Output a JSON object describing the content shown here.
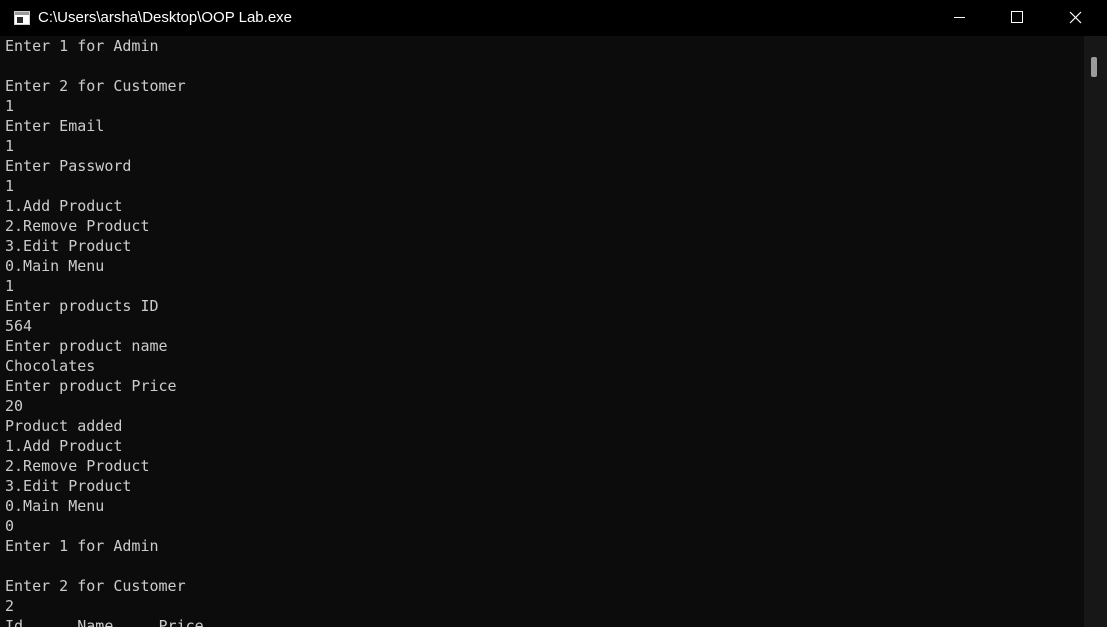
{
  "window": {
    "title": "C:\\Users\\arsha\\Desktop\\OOP Lab.exe"
  },
  "console": {
    "lines": [
      "Enter 1 for Admin",
      "",
      "Enter 2 for Customer",
      "1",
      "Enter Email",
      "1",
      "Enter Password",
      "1",
      "1.Add Product",
      "2.Remove Product",
      "3.Edit Product",
      "0.Main Menu",
      "1",
      "Enter products ID",
      "564",
      "Enter product name",
      "Chocolates",
      "Enter product Price",
      "20",
      "Product added",
      "1.Add Product",
      "2.Remove Product",
      "3.Edit Product",
      "0.Main Menu",
      "0",
      "Enter 1 for Admin",
      "",
      "Enter 2 for Customer",
      "2",
      "Id      Name     Price"
    ]
  },
  "icons": {
    "app": "console-app-icon",
    "minimize": "minimize-icon",
    "maximize": "maximize-icon",
    "close": "close-icon"
  },
  "colors": {
    "titlebar_bg": "#000000",
    "console_bg": "#0c0c0c",
    "console_text": "#cccccc",
    "scrollbar_track": "#171717",
    "scrollbar_thumb": "#9b9b9b"
  }
}
